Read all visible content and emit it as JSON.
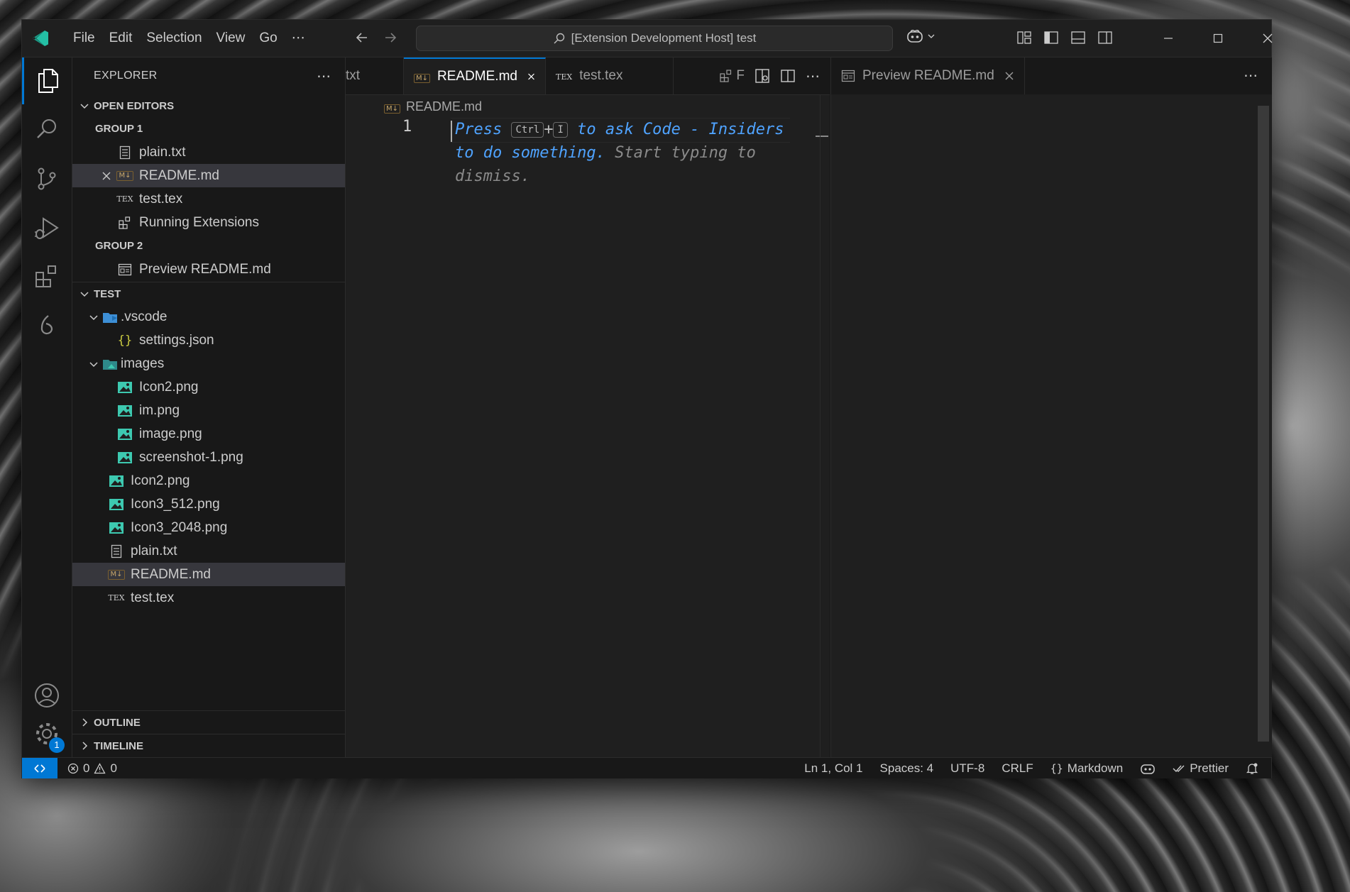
{
  "menu": [
    "File",
    "Edit",
    "Selection",
    "View",
    "Go"
  ],
  "command_center": "[Extension Development Host] test",
  "sidebar": {
    "title": "EXPLORER",
    "open_editors": {
      "label": "OPEN EDITORS",
      "group1": {
        "label": "GROUP 1",
        "items": [
          "plain.txt",
          "README.md",
          "test.tex",
          "Running Extensions"
        ]
      },
      "group2": {
        "label": "GROUP 2",
        "items": [
          "Preview README.md"
        ]
      }
    },
    "folder": {
      "label": "TEST",
      "vscode": {
        "name": ".vscode",
        "children": [
          "settings.json"
        ]
      },
      "images": {
        "name": "images",
        "children": [
          "Icon2.png",
          "im.png",
          "image.png",
          "screenshot-1.png"
        ]
      },
      "files": [
        "Icon2.png",
        "Icon3_512.png",
        "Icon3_2048.png",
        "plain.txt",
        "README.md",
        "test.tex"
      ]
    },
    "outline": "OUTLINE",
    "timeline": "TIMELINE"
  },
  "editor1": {
    "tabs": [
      "txt",
      "README.md",
      "test.tex"
    ],
    "tab_overflow_letter": "F",
    "breadcrumb": "README.md",
    "line_number": "1",
    "ghost": {
      "press": "Press",
      "key1": "Ctrl",
      "plus": "+",
      "key2": "I",
      "hint": "to ask Code - Insiders to do something.",
      "rest": "Start typing to dismiss."
    }
  },
  "editor2": {
    "tab": "Preview README.md"
  },
  "statusbar": {
    "errors": "0",
    "warnings": "0",
    "position": "Ln 1, Col 1",
    "spaces": "Spaces: 4",
    "encoding": "UTF-8",
    "eol": "CRLF",
    "language": "Markdown",
    "prettier": "Prettier"
  },
  "activity": {
    "manage_badge": "1"
  },
  "colors": {
    "accent": "#0078d4",
    "image_icon": "#3dc9b0",
    "json_icon": "#cbcb41"
  }
}
